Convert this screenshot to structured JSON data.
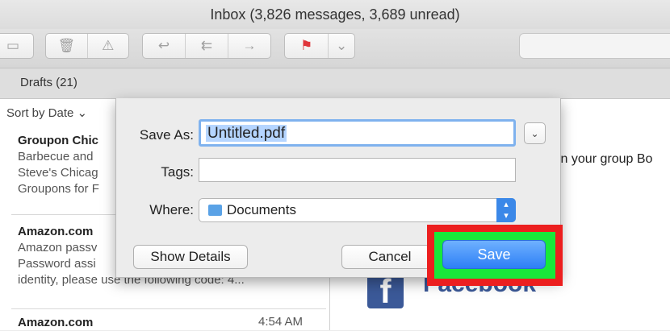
{
  "window": {
    "title": "Inbox (3,826 messages, 3,689 unread)"
  },
  "toolbar": {
    "icons": [
      "archive-icon",
      "trash-icon",
      "junk-icon",
      "reply-icon",
      "reply-all-icon",
      "forward-icon",
      "flag-icon",
      "chevron-down-icon"
    ],
    "glyphs": {
      "archive": "▭",
      "trash": "🗑",
      "junk": "⚠",
      "reply": "↩",
      "reply_all": "⇇",
      "forward": "→",
      "flag": "⚑",
      "chevron": "⌄"
    },
    "flag_color": "#e0353b"
  },
  "favorites": {
    "drafts_label": "Drafts (21)"
  },
  "message_list": {
    "sort_label": "Sort by Date ⌄",
    "messages": [
      {
        "sender": "Groupon Chic",
        "lines": [
          "Barbecue and",
          "Steve's Chicag",
          "Groupons for F"
        ]
      },
      {
        "sender": "Amazon.com",
        "lines": [
          "Amazon passv",
          "Password assi",
          "identity, please use the following code: 4..."
        ]
      },
      {
        "sender": "Amazon.com",
        "time": "4:54 AM"
      }
    ]
  },
  "reading_pane": {
    "fragment": "in your group Bo",
    "facebook_letter": "f",
    "facebook_word": "Facebook",
    "brand_color": "#3b5998"
  },
  "save_dialog": {
    "save_as_label": "Save As:",
    "save_as_value": "Untitled.pdf",
    "tags_label": "Tags:",
    "tags_value": "",
    "where_label": "Where:",
    "where_value": "Documents",
    "show_details_label": "Show Details",
    "cancel_label": "Cancel",
    "save_label": "Save",
    "highlight_outer_color": "#ec1f1f",
    "highlight_inner_color": "#18e83a"
  }
}
